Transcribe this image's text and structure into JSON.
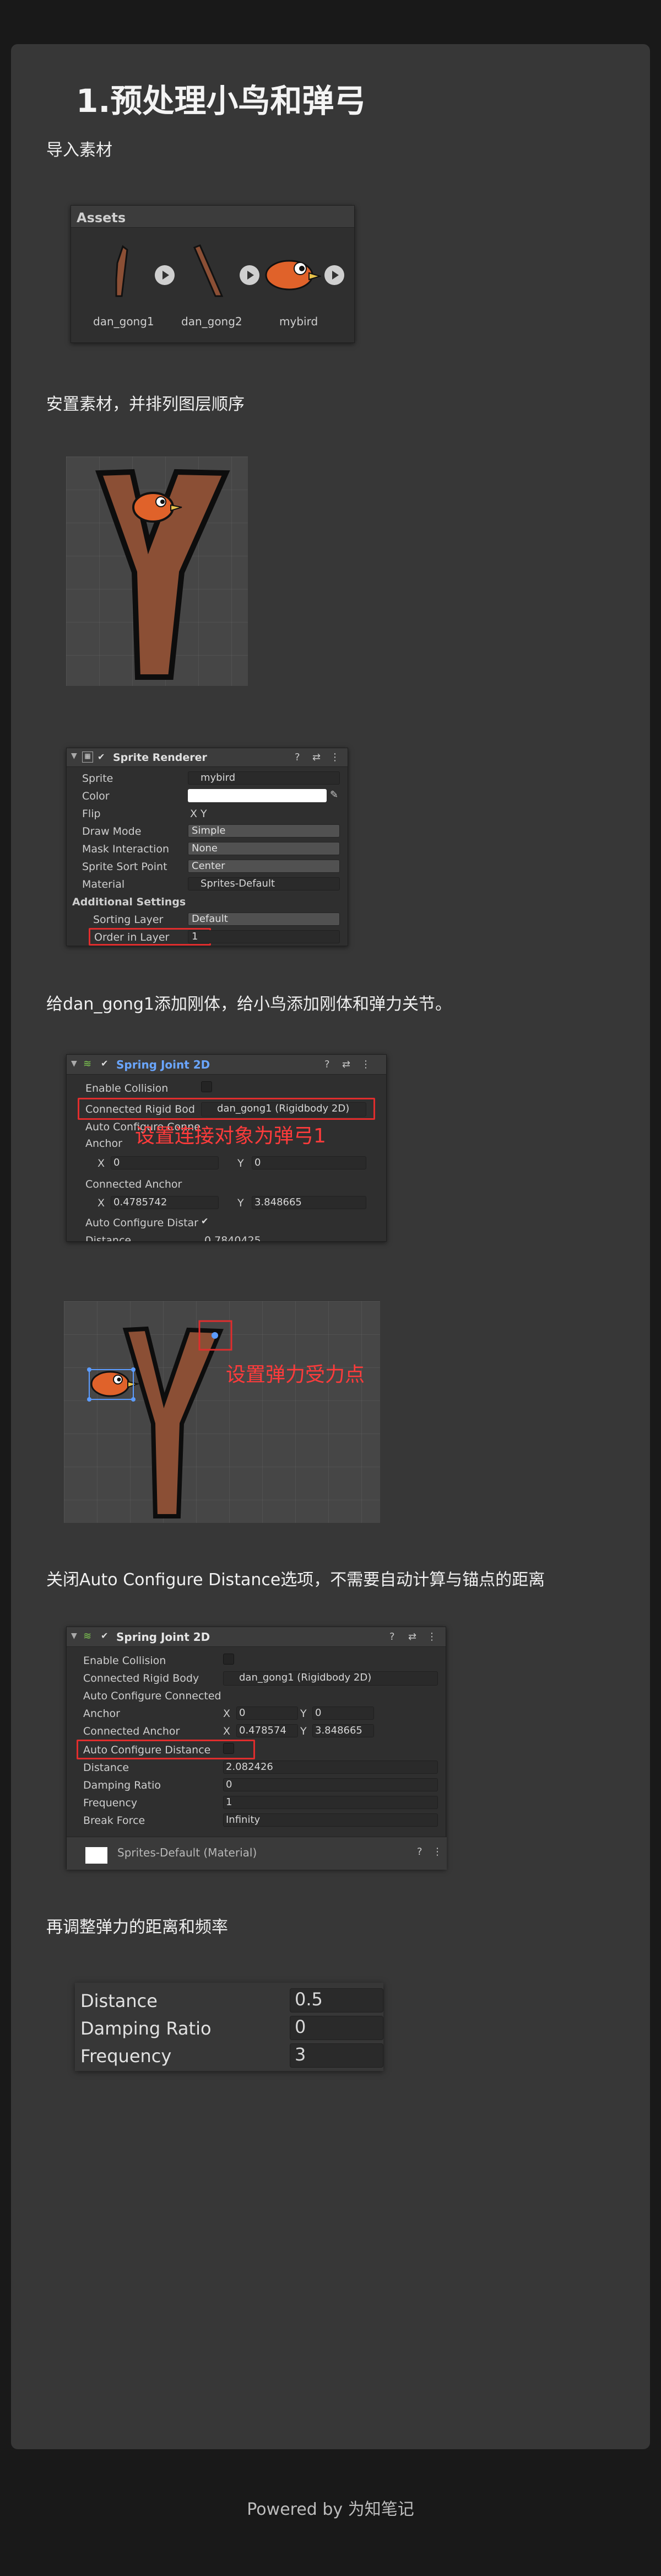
{
  "title": "1.预处理小鸟和弹弓",
  "sections": {
    "import": "导入素材",
    "arrange": "安置素材，并排列图层顺序",
    "physics": "给dan_gong1添加刚体，给小鸟添加刚体和弹力关节。",
    "auto_config": "关闭Auto Configure Distance选项，不需要自动计算与锚点的距离",
    "tune": "再调整弹力的距离和频率"
  },
  "assets_panel": {
    "title": "Assets",
    "items": [
      "dan_gong1",
      "dan_gong2",
      "mybird"
    ]
  },
  "sprite_renderer": {
    "title": "Sprite Renderer",
    "rows": [
      {
        "label": "Sprite",
        "value": "mybird"
      },
      {
        "label": "Color",
        "value": ""
      },
      {
        "label": "Flip",
        "value": "X   Y"
      },
      {
        "label": "Draw Mode",
        "value": "Simple"
      },
      {
        "label": "Mask Interaction",
        "value": "None"
      },
      {
        "label": "Sprite Sort Point",
        "value": "Center"
      },
      {
        "label": "Material",
        "value": "Sprites-Default"
      }
    ],
    "additional": "Additional Settings",
    "sorting_layer_label": "Sorting Layer",
    "sorting_layer_value": "Default",
    "order_label": "Order in Layer",
    "order_value": "1"
  },
  "spring1": {
    "title": "Spring Joint 2D",
    "enable_collision": "Enable Collision",
    "connected_label": "Connected Rigid Bod",
    "connected_value": "dan_gong1 (Rigidbody 2D)",
    "auto_conn": "Auto Configure Conne",
    "anchor": "Anchor",
    "anchor_x": "0",
    "anchor_y": "0",
    "connected_anchor": "Connected Anchor",
    "ca_x": "0.4785742",
    "ca_y": "3.848665",
    "auto_dist": "Auto Configure Distar",
    "distance_partial": "Distance",
    "distance_value_partial": "0.7840425",
    "note": "设置连接对象为弹弓1"
  },
  "scene2_note": "设置弹力受力点",
  "spring2": {
    "title": "Spring Joint 2D",
    "rows": [
      {
        "label": "Enable Collision",
        "value": ""
      },
      {
        "label": "Connected Rigid Body",
        "value": "dan_gong1 (Rigidbody 2D)"
      },
      {
        "label": "Auto Configure Connected",
        "value": ""
      }
    ],
    "anchor": "Anchor",
    "anchor_x": "0",
    "anchor_y": "0",
    "connected_anchor": "Connected Anchor",
    "ca_x": "0.478574",
    "ca_y": "3.848665",
    "auto_dist": "Auto Configure Distance",
    "distance": "Distance",
    "distance_value": "2.082426",
    "damping": "Damping Ratio",
    "damping_value": "0",
    "frequency": "Frequency",
    "frequency_value": "1",
    "break_force": "Break Force",
    "break_force_value": "Infinity",
    "material": "Sprites-Default (Material)"
  },
  "tune_table": [
    {
      "label": "Distance",
      "value": "0.5"
    },
    {
      "label": "Damping Ratio",
      "value": "0"
    },
    {
      "label": "Frequency",
      "value": "3"
    }
  ],
  "footer": "Powered by 为知笔记",
  "colors": {
    "bird": "#e0622a",
    "slingshot": "#8b4f35",
    "outline": "#111111",
    "annotation": "#e02d2d",
    "accent_blue": "#5c9cff"
  }
}
